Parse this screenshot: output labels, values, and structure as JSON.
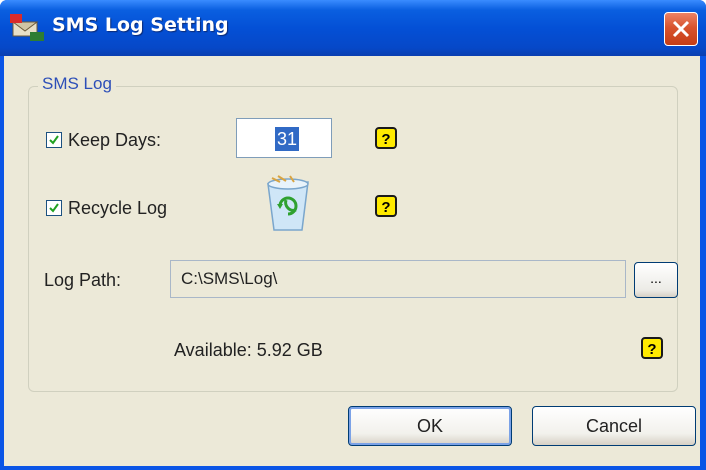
{
  "window": {
    "title": "SMS Log Setting",
    "app_icon": "sms-app-icon",
    "close_icon": "close-icon"
  },
  "group": {
    "legend": "SMS Log",
    "keep_days": {
      "label": "Keep Days:",
      "checked": true,
      "value": "31"
    },
    "recycle_log": {
      "label": "Recycle Log",
      "checked": true,
      "icon": "recycle-bin-icon"
    },
    "log_path": {
      "label": "Log Path:",
      "value": "C:\\SMS\\Log\\",
      "browse_label": "..."
    },
    "available": "Available: 5.92 GB",
    "help_icon": "help-icon"
  },
  "buttons": {
    "ok": "OK",
    "cancel": "Cancel"
  },
  "colors": {
    "titlebar": "#0450d6",
    "dialog_bg": "#ece9d8",
    "legend_text": "#2d4fb8",
    "close_button": "#d8532e",
    "selection": "#316ac5",
    "help_icon": "#ffea00"
  }
}
